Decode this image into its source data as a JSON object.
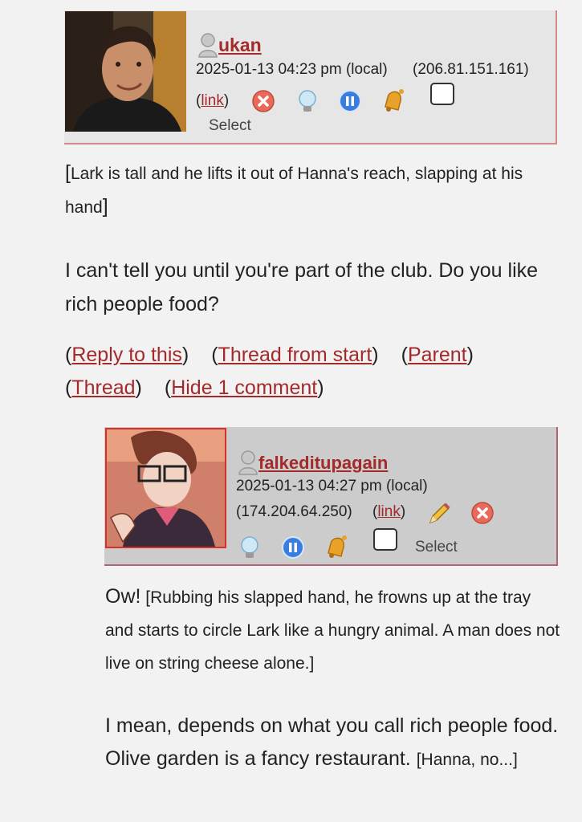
{
  "comment1": {
    "username": "ukan",
    "timestamp": "2025-01-13 04:23 pm (local)",
    "ip": "(206.81.151.161)",
    "link_label": "link",
    "select_label": "Select",
    "body_action": "Lark is tall and he lifts it out of Hanna's reach, slapping at his hand",
    "body_speech": "I can't tell you until you're part of the club. Do you like rich people food?"
  },
  "actions": {
    "reply": "Reply to this",
    "thread_start": "Thread from start",
    "parent": "Parent",
    "thread": "Thread",
    "hide": "Hide 1 comment"
  },
  "comment2": {
    "username": "falkeditupagain",
    "timestamp": "2025-01-13 04:27 pm (local)",
    "ip": "(174.204.64.250)",
    "link_label": "link",
    "select_label": "Select",
    "body_speech1": "Ow!",
    "body_action1": "Rubbing his slapped hand, he frowns up at the tray and starts to circle Lark like a hungry animal. A man does not live on string cheese alone.",
    "body_speech2": "I mean, depends on what you call rich people food. Olive garden is a fancy restaurant.",
    "body_action2": "Hanna, no..."
  },
  "icons": [
    "user-icon",
    "delete-icon",
    "track-icon",
    "freeze-icon",
    "screen-icon",
    "edit-icon"
  ],
  "colors": {
    "link": "#a32a2a",
    "header1_bg": "#e6e6e6",
    "header2_bg": "#cccccc",
    "avatar2_border": "#d6302a"
  }
}
